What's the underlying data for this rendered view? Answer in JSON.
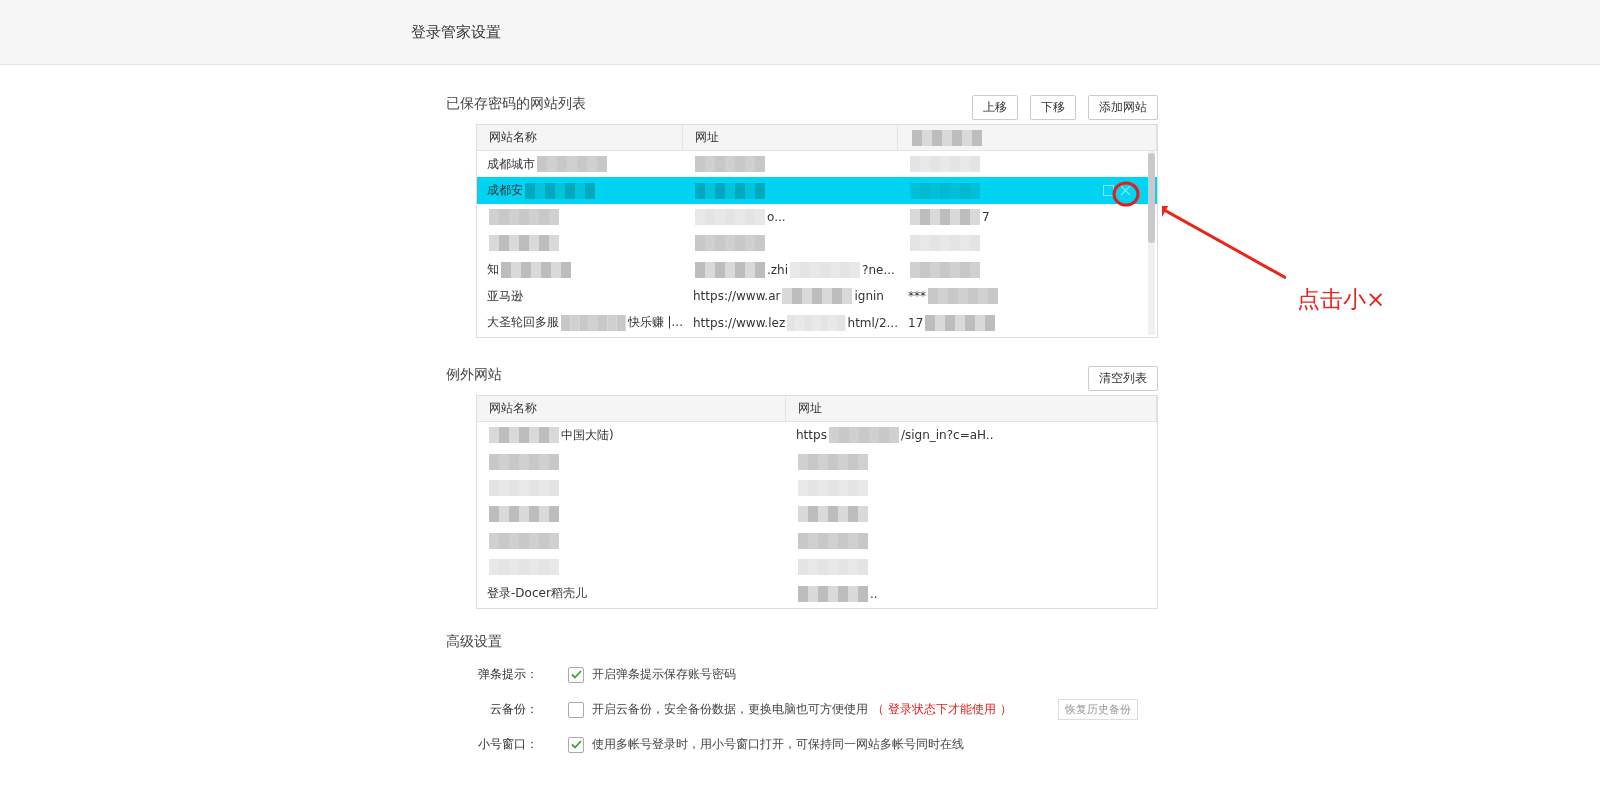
{
  "header": {
    "title": "登录管家设置"
  },
  "saved_sites": {
    "title": "已保存密码的网站列表",
    "buttons": [
      "上移",
      "下移",
      "添加网站"
    ],
    "columns": [
      "网站名称",
      "网址"
    ],
    "rows": [
      {
        "selected": false,
        "cells": [
          [
            {
              "kind": "text",
              "text": "成都城市"
            },
            {
              "kind": "redacted"
            }
          ],
          [
            {
              "kind": "redacted"
            }
          ],
          [
            {
              "kind": "redacted"
            }
          ]
        ]
      },
      {
        "selected": true,
        "cells": [
          [
            {
              "kind": "text",
              "text": "成都安"
            },
            {
              "kind": "redacted"
            }
          ],
          [
            {
              "kind": "redacted"
            }
          ],
          [
            {
              "kind": "redacted"
            }
          ]
        ]
      },
      {
        "selected": false,
        "cells": [
          [
            {
              "kind": "redacted"
            }
          ],
          [
            {
              "kind": "redacted"
            },
            {
              "kind": "text",
              "text": "o..."
            }
          ],
          [
            {
              "kind": "redacted"
            },
            {
              "kind": "text",
              "text": "7"
            }
          ]
        ]
      },
      {
        "selected": false,
        "cells": [
          [
            {
              "kind": "redacted"
            }
          ],
          [
            {
              "kind": "redacted"
            }
          ],
          [
            {
              "kind": "redacted"
            }
          ]
        ]
      },
      {
        "selected": false,
        "cells": [
          [
            {
              "kind": "text",
              "text": "知"
            },
            {
              "kind": "redacted"
            }
          ],
          [
            {
              "kind": "redacted"
            },
            {
              "kind": "text",
              "text": ".zhi"
            },
            {
              "kind": "redacted"
            },
            {
              "kind": "text",
              "text": "?ne..."
            }
          ],
          [
            {
              "kind": "redacted"
            }
          ]
        ]
      },
      {
        "selected": false,
        "cells": [
          [
            {
              "kind": "text",
              "text": "亚马逊"
            }
          ],
          [
            {
              "kind": "text",
              "text": "https://www.ar"
            },
            {
              "kind": "redacted"
            },
            {
              "kind": "text",
              "text": "ignin"
            }
          ],
          [
            {
              "kind": "text",
              "text": "***"
            },
            {
              "kind": "redacted"
            }
          ]
        ]
      },
      {
        "selected": false,
        "cells": [
          [
            {
              "kind": "text",
              "text": "大圣轮回多服"
            },
            {
              "kind": "redacted"
            },
            {
              "kind": "text",
              "text": "快乐赚 |..."
            }
          ],
          [
            {
              "kind": "text",
              "text": "https://www.lez"
            },
            {
              "kind": "redacted"
            },
            {
              "kind": "text",
              "text": "html/2..."
            }
          ],
          [
            {
              "kind": "text",
              "text": "17"
            },
            {
              "kind": "redacted"
            }
          ]
        ]
      }
    ]
  },
  "exception_sites": {
    "title": "例外网站",
    "button": "清空列表",
    "columns": [
      "网站名称",
      "网址"
    ],
    "rows": [
      {
        "cells": [
          [
            {
              "kind": "redacted"
            },
            {
              "kind": "text",
              "text": "中国大陆)"
            }
          ],
          [
            {
              "kind": "text",
              "text": "https"
            },
            {
              "kind": "redacted"
            },
            {
              "kind": "text",
              "text": "/sign_in?c=aH.."
            }
          ]
        ]
      },
      {
        "cells": [
          [
            {
              "kind": "redacted"
            }
          ],
          [
            {
              "kind": "redacted"
            }
          ]
        ]
      },
      {
        "cells": [
          [
            {
              "kind": "redacted"
            }
          ],
          [
            {
              "kind": "redacted"
            }
          ]
        ]
      },
      {
        "cells": [
          [
            {
              "kind": "redacted"
            }
          ],
          [
            {
              "kind": "redacted"
            }
          ]
        ]
      },
      {
        "cells": [
          [
            {
              "kind": "redacted"
            }
          ],
          [
            {
              "kind": "redacted"
            }
          ]
        ]
      },
      {
        "cells": [
          [
            {
              "kind": "redacted"
            }
          ],
          [
            {
              "kind": "redacted"
            }
          ]
        ]
      },
      {
        "cells": [
          [
            {
              "kind": "text",
              "text": "登录-Docer稻壳儿"
            }
          ],
          [
            {
              "kind": "redacted"
            },
            {
              "kind": "text",
              "text": ".."
            }
          ]
        ]
      }
    ]
  },
  "advanced": {
    "title": "高级设置",
    "options": [
      {
        "label": "弹条提示：",
        "checked": true,
        "text": "开启弹条提示保存账号密码"
      },
      {
        "label": "云备份：",
        "checked": false,
        "text": "开启云备份，安全备份数据，更换电脑也可方便使用",
        "note": "（ 登录状态下才能使用 ）",
        "button": "恢复历史备份"
      },
      {
        "label": "小号窗口：",
        "checked": true,
        "text": "使用多帐号登录时，用小号窗口打开，可保持同一网站多帐号同时在线"
      }
    ]
  },
  "annotation": {
    "text": "点击小×"
  }
}
